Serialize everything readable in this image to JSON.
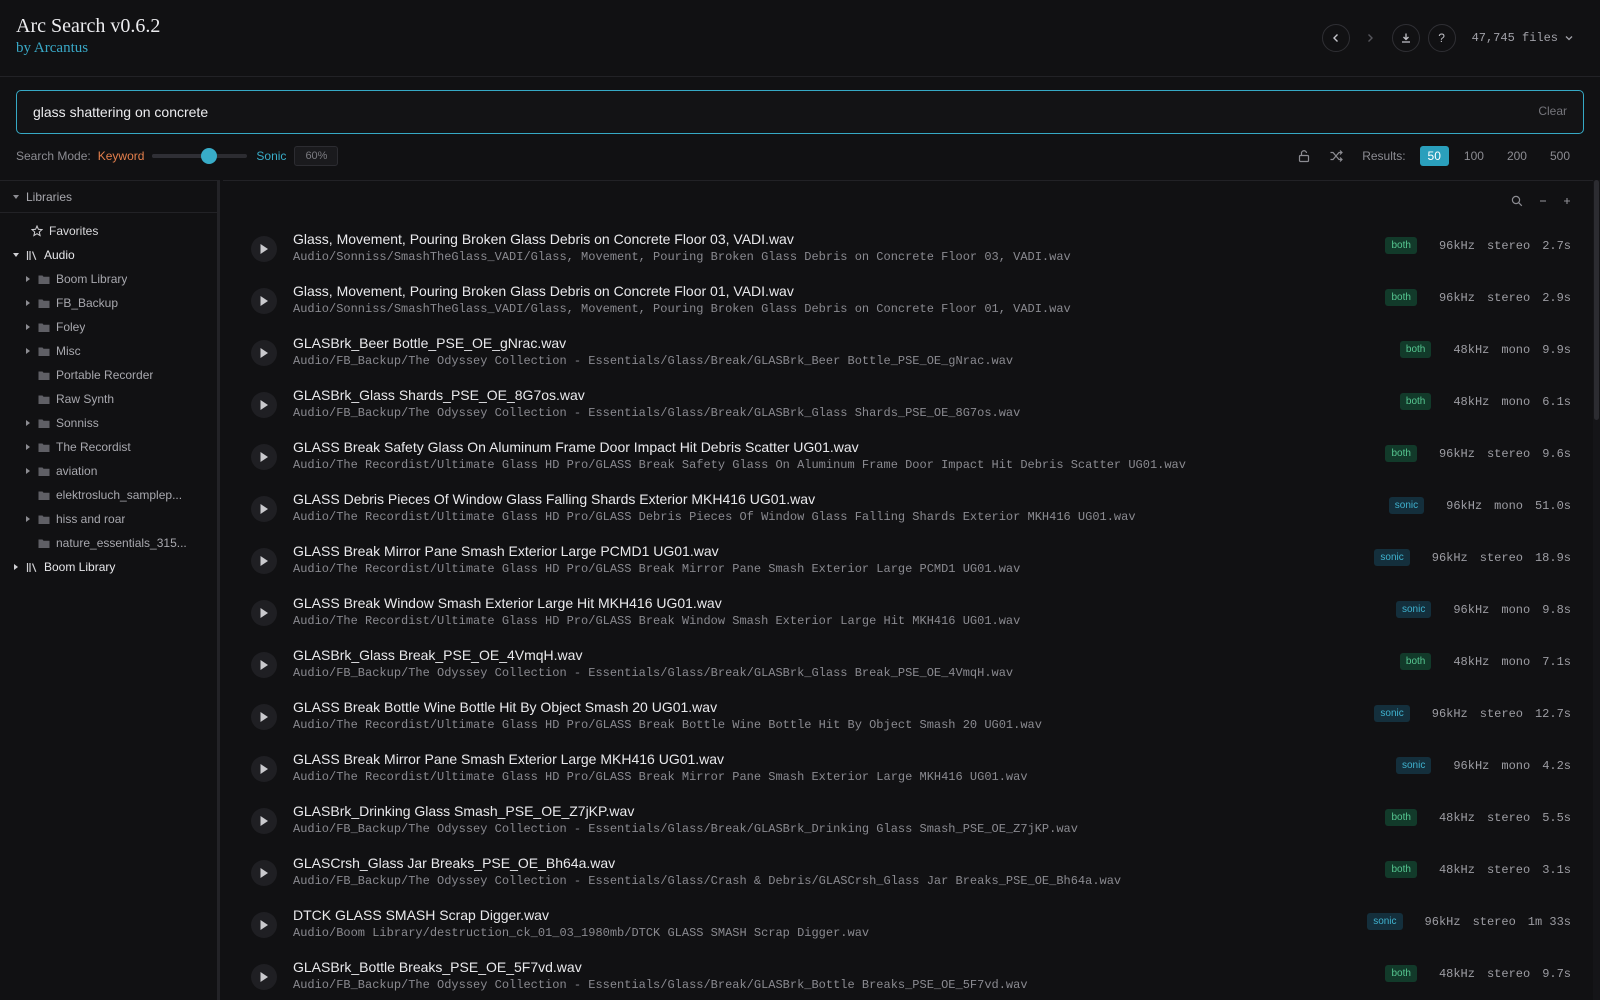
{
  "app": {
    "title": "Arc Search v0.6.2",
    "subtitle": "by Arcantus",
    "file_count": "47,745 files"
  },
  "search": {
    "query": "glass shattering on concrete",
    "clear_label": "Clear"
  },
  "mode": {
    "label": "Search Mode:",
    "keyword_label": "Keyword",
    "sonic_label": "Sonic",
    "percent_text": "60%",
    "slider_value": 0.6
  },
  "results_control": {
    "label": "Results:",
    "options": [
      "50",
      "100",
      "200",
      "500"
    ],
    "selected": "50"
  },
  "sidebar": {
    "header": "Libraries",
    "favorites": "Favorites",
    "libraries": [
      {
        "name": "Audio",
        "expanded": true,
        "folders": [
          {
            "name": "Boom Library",
            "has_children": true
          },
          {
            "name": "FB_Backup",
            "has_children": true
          },
          {
            "name": "Foley",
            "has_children": true
          },
          {
            "name": "Misc",
            "has_children": true
          },
          {
            "name": "Portable Recorder",
            "has_children": false
          },
          {
            "name": "Raw Synth",
            "has_children": false
          },
          {
            "name": "Sonniss",
            "has_children": true
          },
          {
            "name": "The Recordist",
            "has_children": true
          },
          {
            "name": "aviation",
            "has_children": true
          },
          {
            "name": "elektrosluch_samplep...",
            "has_children": false
          },
          {
            "name": "hiss and roar",
            "has_children": true
          },
          {
            "name": "nature_essentials_315...",
            "has_children": false
          }
        ]
      },
      {
        "name": "Boom Library",
        "expanded": false,
        "folders": []
      }
    ]
  },
  "results": [
    {
      "title": "Glass, Movement, Pouring Broken Glass Debris on Concrete Floor 03, VADI.wav",
      "path": "Audio/Sonniss/SmashTheGlass_VADI/Glass, Movement, Pouring Broken Glass Debris on Concrete Floor 03, VADI.wav",
      "match": "both",
      "rate": "96kHz",
      "channels": "stereo",
      "duration": "2.7s"
    },
    {
      "title": "Glass, Movement, Pouring Broken Glass Debris on Concrete Floor 01, VADI.wav",
      "path": "Audio/Sonniss/SmashTheGlass_VADI/Glass, Movement, Pouring Broken Glass Debris on Concrete Floor 01, VADI.wav",
      "match": "both",
      "rate": "96kHz",
      "channels": "stereo",
      "duration": "2.9s"
    },
    {
      "title": "GLASBrk_Beer Bottle_PSE_OE_gNrac.wav",
      "path": "Audio/FB_Backup/The Odyssey Collection - Essentials/Glass/Break/GLASBrk_Beer Bottle_PSE_OE_gNrac.wav",
      "match": "both",
      "rate": "48kHz",
      "channels": "mono",
      "duration": "9.9s"
    },
    {
      "title": "GLASBrk_Glass Shards_PSE_OE_8G7os.wav",
      "path": "Audio/FB_Backup/The Odyssey Collection - Essentials/Glass/Break/GLASBrk_Glass Shards_PSE_OE_8G7os.wav",
      "match": "both",
      "rate": "48kHz",
      "channels": "mono",
      "duration": "6.1s"
    },
    {
      "title": "GLASS Break Safety Glass On Aluminum Frame Door Impact Hit Debris Scatter UG01.wav",
      "path": "Audio/The Recordist/Ultimate Glass HD Pro/GLASS Break Safety Glass On Aluminum Frame Door Impact Hit Debris Scatter UG01.wav",
      "match": "both",
      "rate": "96kHz",
      "channels": "stereo",
      "duration": "9.6s"
    },
    {
      "title": "GLASS Debris Pieces Of Window Glass Falling Shards Exterior MKH416 UG01.wav",
      "path": "Audio/The Recordist/Ultimate Glass HD Pro/GLASS Debris Pieces Of Window Glass Falling Shards Exterior MKH416 UG01.wav",
      "match": "sonic",
      "rate": "96kHz",
      "channels": "mono",
      "duration": "51.0s"
    },
    {
      "title": "GLASS Break Mirror Pane Smash Exterior Large PCMD1 UG01.wav",
      "path": "Audio/The Recordist/Ultimate Glass HD Pro/GLASS Break Mirror Pane Smash Exterior Large PCMD1 UG01.wav",
      "match": "sonic",
      "rate": "96kHz",
      "channels": "stereo",
      "duration": "18.9s"
    },
    {
      "title": "GLASS Break Window Smash Exterior Large Hit MKH416 UG01.wav",
      "path": "Audio/The Recordist/Ultimate Glass HD Pro/GLASS Break Window Smash Exterior Large Hit MKH416 UG01.wav",
      "match": "sonic",
      "rate": "96kHz",
      "channels": "mono",
      "duration": "9.8s"
    },
    {
      "title": "GLASBrk_Glass Break_PSE_OE_4VmqH.wav",
      "path": "Audio/FB_Backup/The Odyssey Collection - Essentials/Glass/Break/GLASBrk_Glass Break_PSE_OE_4VmqH.wav",
      "match": "both",
      "rate": "48kHz",
      "channels": "mono",
      "duration": "7.1s"
    },
    {
      "title": "GLASS Break Bottle Wine Bottle Hit By Object Smash 20 UG01.wav",
      "path": "Audio/The Recordist/Ultimate Glass HD Pro/GLASS Break Bottle Wine Bottle Hit By Object Smash 20 UG01.wav",
      "match": "sonic",
      "rate": "96kHz",
      "channels": "stereo",
      "duration": "12.7s"
    },
    {
      "title": "GLASS Break Mirror Pane Smash Exterior Large MKH416 UG01.wav",
      "path": "Audio/The Recordist/Ultimate Glass HD Pro/GLASS Break Mirror Pane Smash Exterior Large MKH416 UG01.wav",
      "match": "sonic",
      "rate": "96kHz",
      "channels": "mono",
      "duration": "4.2s"
    },
    {
      "title": "GLASBrk_Drinking Glass Smash_PSE_OE_Z7jKP.wav",
      "path": "Audio/FB_Backup/The Odyssey Collection - Essentials/Glass/Break/GLASBrk_Drinking Glass Smash_PSE_OE_Z7jKP.wav",
      "match": "both",
      "rate": "48kHz",
      "channels": "stereo",
      "duration": "5.5s"
    },
    {
      "title": "GLASCrsh_Glass Jar Breaks_PSE_OE_Bh64a.wav",
      "path": "Audio/FB_Backup/The Odyssey Collection - Essentials/Glass/Crash & Debris/GLASCrsh_Glass Jar Breaks_PSE_OE_Bh64a.wav",
      "match": "both",
      "rate": "48kHz",
      "channels": "stereo",
      "duration": "3.1s"
    },
    {
      "title": "DTCK GLASS SMASH Scrap Digger.wav",
      "path": "Audio/Boom Library/destruction_ck_01_03_1980mb/DTCK GLASS SMASH Scrap Digger.wav",
      "match": "sonic",
      "rate": "96kHz",
      "channels": "stereo",
      "duration": "1m 33s"
    },
    {
      "title": "GLASBrk_Bottle Breaks_PSE_OE_5F7vd.wav",
      "path": "Audio/FB_Backup/The Odyssey Collection - Essentials/Glass/Break/GLASBrk_Bottle Breaks_PSE_OE_5F7vd.wav",
      "match": "both",
      "rate": "48kHz",
      "channels": "stereo",
      "duration": "9.7s"
    }
  ],
  "colors": {
    "accent": "#38acc8",
    "keyword": "#e47f4c",
    "badge_both": "#56c791",
    "badge_sonic": "#3fb2cf"
  },
  "icons": {
    "back": "chevron-left-icon",
    "forward": "chevron-right-icon",
    "download": "download-icon",
    "help": "help-icon",
    "unlock": "unlock-icon",
    "shuffle": "shuffle-icon",
    "search": "search-icon",
    "play": "play-icon",
    "folder": "folder-icon",
    "library": "library-icon",
    "favorite": "star-icon"
  }
}
